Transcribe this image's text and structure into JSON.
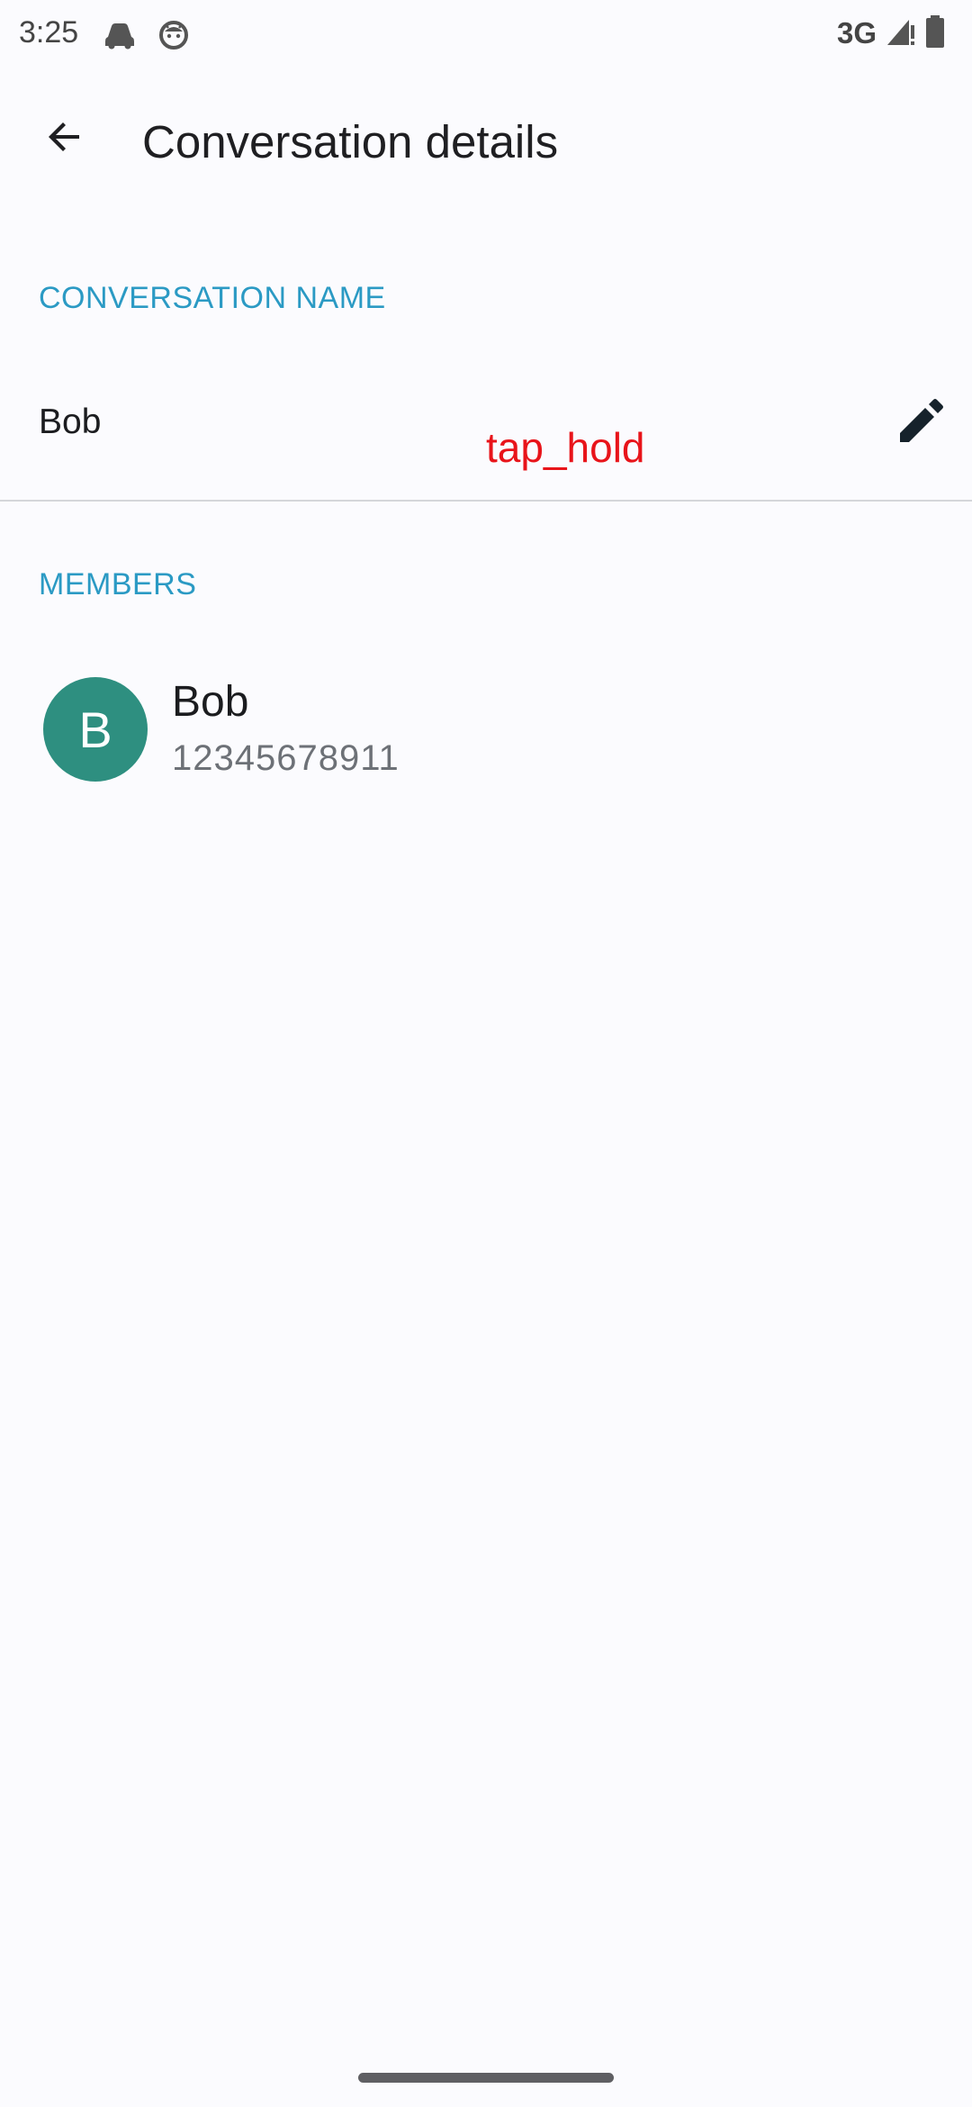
{
  "status_bar": {
    "time": "3:25",
    "left_icons": [
      "car-icon",
      "android-face-icon"
    ],
    "network": "3G",
    "right_icons": [
      "signal-icon",
      "battery-icon"
    ]
  },
  "app_bar": {
    "back_icon": "arrow-back-icon",
    "title": "Conversation details"
  },
  "conversation_name": {
    "header": "CONVERSATION NAME",
    "value": "Bob",
    "edit_icon": "pencil-icon"
  },
  "overlay": {
    "label": "tap_hold",
    "color": "#e8141a"
  },
  "members": {
    "header": "MEMBERS",
    "items": [
      {
        "initial": "B",
        "name": "Bob",
        "phone": "12345678911",
        "avatar_color": "#2e8f80"
      }
    ]
  },
  "colors": {
    "accent": "#2b9ac4",
    "background": "#fbfbfe"
  }
}
